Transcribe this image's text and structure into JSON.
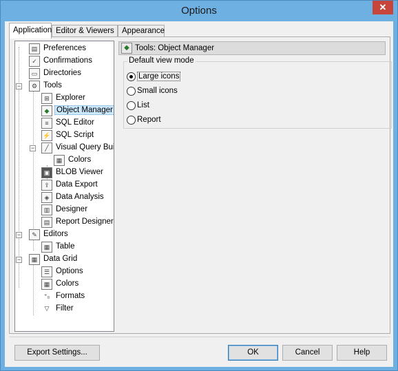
{
  "window": {
    "title": "Options",
    "close_glyph": "✕"
  },
  "tabs": [
    {
      "label": "Application",
      "active": true
    },
    {
      "label": "Editor & Viewers",
      "active": false
    },
    {
      "label": "Appearance",
      "active": false
    }
  ],
  "tree": {
    "items": [
      {
        "label": "Preferences",
        "icon": "preferences-icon"
      },
      {
        "label": "Confirmations",
        "icon": "confirmations-icon"
      },
      {
        "label": "Directories",
        "icon": "folder-icon"
      },
      {
        "label": "Tools",
        "icon": "tools-icon",
        "expander": "−"
      },
      {
        "label": "Explorer",
        "icon": "explorer-icon"
      },
      {
        "label": "Object Manager",
        "icon": "object-manager-icon",
        "selected": true
      },
      {
        "label": "SQL Editor",
        "icon": "sql-editor-icon"
      },
      {
        "label": "SQL Script",
        "icon": "sql-script-icon"
      },
      {
        "label": "Visual Query Build",
        "icon": "visual-query-icon",
        "expander": "−"
      },
      {
        "label": "Colors",
        "icon": "colors-icon"
      },
      {
        "label": "BLOB Viewer",
        "icon": "blob-viewer-icon"
      },
      {
        "label": "Data Export",
        "icon": "data-export-icon"
      },
      {
        "label": "Data Analysis",
        "icon": "data-analysis-icon"
      },
      {
        "label": "Designer",
        "icon": "designer-icon"
      },
      {
        "label": "Report Designer",
        "icon": "report-designer-icon"
      },
      {
        "label": "Editors",
        "icon": "editors-icon",
        "expander": "−"
      },
      {
        "label": "Table",
        "icon": "table-icon"
      },
      {
        "label": "Data Grid",
        "icon": "data-grid-icon",
        "expander": "−"
      },
      {
        "label": "Options",
        "icon": "options-icon"
      },
      {
        "label": "Colors",
        "icon": "colors-icon"
      },
      {
        "label": "Formats",
        "icon": "formats-icon"
      },
      {
        "label": "Filter",
        "icon": "filter-icon"
      }
    ]
  },
  "panel": {
    "header": "Tools: Object Manager",
    "group_label": "Default view mode",
    "options": [
      {
        "label": "Large icons",
        "checked": true
      },
      {
        "label": "Small icons",
        "checked": false
      },
      {
        "label": "List",
        "checked": false
      },
      {
        "label": "Report",
        "checked": false
      }
    ]
  },
  "buttons": {
    "export": "Export Settings...",
    "ok": "OK",
    "cancel": "Cancel",
    "help": "Help"
  }
}
